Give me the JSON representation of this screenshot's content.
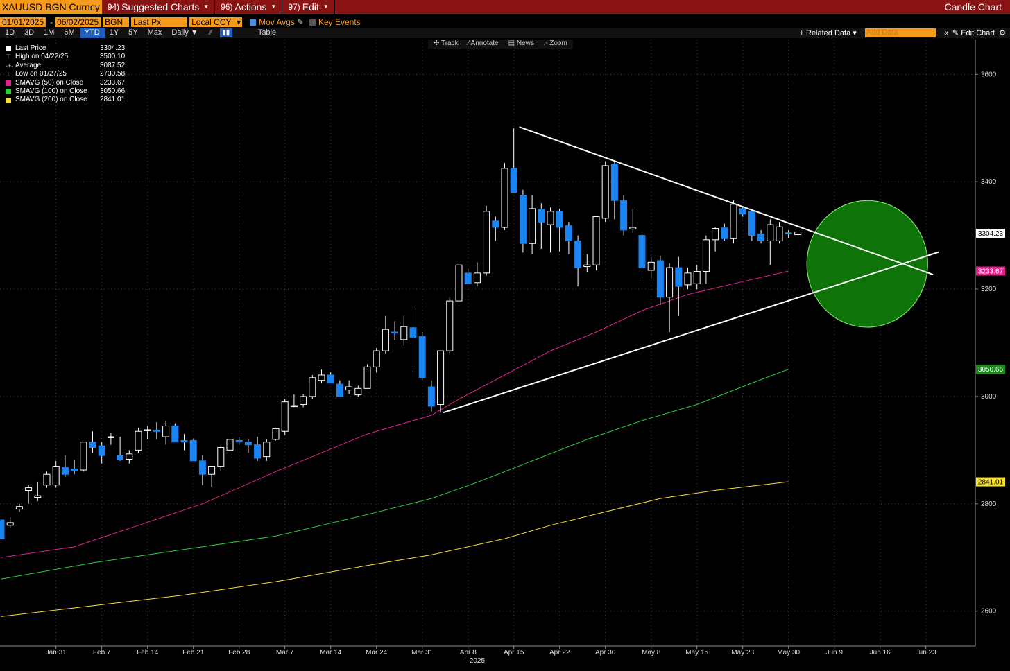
{
  "header": {
    "ticker": "XAUUSD BGN Curncy",
    "menus": [
      {
        "num": "94)",
        "label": "Suggested Charts"
      },
      {
        "num": "96)",
        "label": "Actions"
      },
      {
        "num": "97)",
        "label": "Edit"
      }
    ],
    "title": "Candle Chart"
  },
  "settings": {
    "start_date": "01/01/2025",
    "end_date": "06/02/2025",
    "source": "BGN",
    "field": "Last Px",
    "currency": "Local CCY",
    "mov_avgs_label": "Mov Avgs",
    "key_events_label": "Key Events"
  },
  "periods": [
    "1D",
    "3D",
    "1M",
    "6M",
    "YTD",
    "1Y",
    "5Y",
    "Max"
  ],
  "active_period": "YTD",
  "frequency": "Daily",
  "table_label": "Table",
  "related_data_label": "Related Data",
  "add_data_placeholder": "Add Data",
  "edit_chart_label": "Edit Chart",
  "tools": [
    "Track",
    "Annotate",
    "News",
    "Zoom"
  ],
  "legend": [
    {
      "label": "Last Price",
      "value": "3304.23",
      "color": "#ffffff",
      "sym": "square"
    },
    {
      "label": "High on 04/22/25",
      "value": "3500.10",
      "color": "#bbbbbb",
      "sym": "high"
    },
    {
      "label": "Average",
      "value": "3087.52",
      "color": "#bbbbbb",
      "sym": "avg"
    },
    {
      "label": "Low on 01/27/25",
      "value": "2730.58",
      "color": "#bbbbbb",
      "sym": "low"
    },
    {
      "label": "SMAVG (50)  on Close",
      "value": "3233.67",
      "color": "#e0218a",
      "sym": "square"
    },
    {
      "label": "SMAVG (100)  on Close",
      "value": "3050.66",
      "color": "#2ecc40",
      "sym": "square"
    },
    {
      "label": "SMAVG (200)  on Close",
      "value": "2841.01",
      "color": "#f7e03a",
      "sym": "square"
    }
  ],
  "chart_data": {
    "type": "candlestick",
    "ylim": [
      2535,
      3665
    ],
    "y_ticks": [
      2600,
      2800,
      3000,
      3200,
      3400,
      3600
    ],
    "x_ticks": [
      "Jan 31",
      "Feb 7",
      "Feb 14",
      "Feb 21",
      "Feb 28",
      "Mar 7",
      "Mar 14",
      "Mar 24",
      "Mar 31",
      "Apr 8",
      "Apr 15",
      "Apr 22",
      "Apr 30",
      "May 8",
      "May 15",
      "May 23",
      "May 30",
      "Jun 9",
      "Jun 16",
      "Jun 23"
    ],
    "x_year_label": "2025",
    "last_price_label": "3304.23",
    "colors": {
      "up_fill": "#000000",
      "up_border": "#ffffff",
      "down_fill": "#1a84f2",
      "last_fill": "#3ac6b4"
    },
    "candles": [
      {
        "o": 2770,
        "h": 2773,
        "l": 2731,
        "c": 2735
      },
      {
        "o": 2760,
        "h": 2775,
        "l": 2755,
        "c": 2765
      },
      {
        "o": 2790,
        "h": 2800,
        "l": 2785,
        "c": 2795
      },
      {
        "o": 2825,
        "h": 2835,
        "l": 2800,
        "c": 2830
      },
      {
        "o": 2812,
        "h": 2840,
        "l": 2805,
        "c": 2815
      },
      {
        "o": 2835,
        "h": 2860,
        "l": 2830,
        "c": 2855
      },
      {
        "o": 2835,
        "h": 2880,
        "l": 2830,
        "c": 2870
      },
      {
        "o": 2868,
        "h": 2890,
        "l": 2850,
        "c": 2855
      },
      {
        "o": 2865,
        "h": 2882,
        "l": 2855,
        "c": 2862
      },
      {
        "o": 2863,
        "h": 2915,
        "l": 2860,
        "c": 2915
      },
      {
        "o": 2915,
        "h": 2935,
        "l": 2895,
        "c": 2905
      },
      {
        "o": 2908,
        "h": 2915,
        "l": 2875,
        "c": 2890
      },
      {
        "o": 2925,
        "h": 2932,
        "l": 2910,
        "c": 2925
      },
      {
        "o": 2890,
        "h": 2925,
        "l": 2880,
        "c": 2882
      },
      {
        "o": 2883,
        "h": 2900,
        "l": 2875,
        "c": 2893
      },
      {
        "o": 2900,
        "h": 2942,
        "l": 2895,
        "c": 2935
      },
      {
        "o": 2938,
        "h": 2945,
        "l": 2920,
        "c": 2938
      },
      {
        "o": 2937,
        "h": 2952,
        "l": 2920,
        "c": 2935
      },
      {
        "o": 2925,
        "h": 2955,
        "l": 2910,
        "c": 2945
      },
      {
        "o": 2945,
        "h": 2950,
        "l": 2915,
        "c": 2915
      },
      {
        "o": 2918,
        "h": 2930,
        "l": 2900,
        "c": 2915
      },
      {
        "o": 2918,
        "h": 2920,
        "l": 2880,
        "c": 2880
      },
      {
        "o": 2880,
        "h": 2890,
        "l": 2835,
        "c": 2855
      },
      {
        "o": 2855,
        "h": 2870,
        "l": 2832,
        "c": 2870
      },
      {
        "o": 2870,
        "h": 2910,
        "l": 2862,
        "c": 2905
      },
      {
        "o": 2900,
        "h": 2925,
        "l": 2885,
        "c": 2920
      },
      {
        "o": 2918,
        "h": 2925,
        "l": 2910,
        "c": 2915
      },
      {
        "o": 2915,
        "h": 2920,
        "l": 2895,
        "c": 2910
      },
      {
        "o": 2910,
        "h": 2925,
        "l": 2880,
        "c": 2885
      },
      {
        "o": 2888,
        "h": 2920,
        "l": 2880,
        "c": 2915
      },
      {
        "o": 2920,
        "h": 2942,
        "l": 2918,
        "c": 2940
      },
      {
        "o": 2935,
        "h": 2995,
        "l": 2928,
        "c": 2990
      },
      {
        "o": 2983,
        "h": 3004,
        "l": 2980,
        "c": 2983
      },
      {
        "o": 2985,
        "h": 3005,
        "l": 2980,
        "c": 3000
      },
      {
        "o": 3000,
        "h": 3040,
        "l": 2995,
        "c": 3035
      },
      {
        "o": 3030,
        "h": 3050,
        "l": 3025,
        "c": 3040
      },
      {
        "o": 3040,
        "h": 3045,
        "l": 3030,
        "c": 3025
      },
      {
        "o": 3023,
        "h": 3030,
        "l": 3000,
        "c": 3000
      },
      {
        "o": 3012,
        "h": 3030,
        "l": 3005,
        "c": 3018
      },
      {
        "o": 3003,
        "h": 3020,
        "l": 3000,
        "c": 3015
      },
      {
        "o": 3015,
        "h": 3060,
        "l": 3015,
        "c": 3055
      },
      {
        "o": 3055,
        "h": 3090,
        "l": 3045,
        "c": 3085
      },
      {
        "o": 3085,
        "h": 3150,
        "l": 3080,
        "c": 3125
      },
      {
        "o": 3120,
        "h": 3140,
        "l": 3105,
        "c": 3118
      },
      {
        "o": 3106,
        "h": 3150,
        "l": 3095,
        "c": 3130
      },
      {
        "o": 3128,
        "h": 3168,
        "l": 3055,
        "c": 3110
      },
      {
        "o": 3112,
        "h": 3120,
        "l": 3030,
        "c": 3035
      },
      {
        "o": 3018,
        "h": 3030,
        "l": 2972,
        "c": 2982
      },
      {
        "o": 2985,
        "h": 3080,
        "l": 2970,
        "c": 3085
      },
      {
        "o": 3085,
        "h": 3185,
        "l": 3078,
        "c": 3178
      },
      {
        "o": 3178,
        "h": 3248,
        "l": 3170,
        "c": 3245
      },
      {
        "o": 3230,
        "h": 3238,
        "l": 3210,
        "c": 3210
      },
      {
        "o": 3212,
        "h": 3250,
        "l": 3205,
        "c": 3230
      },
      {
        "o": 3230,
        "h": 3355,
        "l": 3225,
        "c": 3345
      },
      {
        "o": 3327,
        "h": 3335,
        "l": 3290,
        "c": 3315
      },
      {
        "o": 3315,
        "h": 3435,
        "l": 3310,
        "c": 3425
      },
      {
        "o": 3425,
        "h": 3500,
        "l": 3380,
        "c": 3380
      },
      {
        "o": 3375,
        "h": 3385,
        "l": 3268,
        "c": 3285
      },
      {
        "o": 3285,
        "h": 3375,
        "l": 3265,
        "c": 3350
      },
      {
        "o": 3349,
        "h": 3360,
        "l": 3275,
        "c": 3325
      },
      {
        "o": 3320,
        "h": 3352,
        "l": 3268,
        "c": 3345
      },
      {
        "o": 3345,
        "h": 3350,
        "l": 3270,
        "c": 3315
      },
      {
        "o": 3318,
        "h": 3325,
        "l": 3265,
        "c": 3290
      },
      {
        "o": 3290,
        "h": 3300,
        "l": 3205,
        "c": 3240
      },
      {
        "o": 3242,
        "h": 3265,
        "l": 3232,
        "c": 3245
      },
      {
        "o": 3245,
        "h": 3330,
        "l": 3235,
        "c": 3335
      },
      {
        "o": 3332,
        "h": 3438,
        "l": 3325,
        "c": 3430
      },
      {
        "o": 3433,
        "h": 3438,
        "l": 3330,
        "c": 3365
      },
      {
        "o": 3365,
        "h": 3375,
        "l": 3300,
        "c": 3310
      },
      {
        "o": 3312,
        "h": 3350,
        "l": 3305,
        "c": 3315
      },
      {
        "o": 3300,
        "h": 3305,
        "l": 3215,
        "c": 3240
      },
      {
        "o": 3235,
        "h": 3260,
        "l": 3220,
        "c": 3250
      },
      {
        "o": 3253,
        "h": 3262,
        "l": 3170,
        "c": 3185
      },
      {
        "o": 3185,
        "h": 3248,
        "l": 3120,
        "c": 3240
      },
      {
        "o": 3240,
        "h": 3260,
        "l": 3150,
        "c": 3205
      },
      {
        "o": 3208,
        "h": 3240,
        "l": 3200,
        "c": 3230
      },
      {
        "o": 3210,
        "h": 3245,
        "l": 3200,
        "c": 3233
      },
      {
        "o": 3233,
        "h": 3300,
        "l": 3210,
        "c": 3292
      },
      {
        "o": 3292,
        "h": 3315,
        "l": 3270,
        "c": 3313
      },
      {
        "o": 3314,
        "h": 3322,
        "l": 3290,
        "c": 3294
      },
      {
        "o": 3294,
        "h": 3365,
        "l": 3285,
        "c": 3358
      },
      {
        "o": 3350,
        "h": 3355,
        "l": 3335,
        "c": 3340
      },
      {
        "o": 3345,
        "h": 3348,
        "l": 3290,
        "c": 3300
      },
      {
        "o": 3303,
        "h": 3310,
        "l": 3285,
        "c": 3290
      },
      {
        "o": 3290,
        "h": 3330,
        "l": 3245,
        "c": 3320
      },
      {
        "o": 3290,
        "h": 3325,
        "l": 3285,
        "c": 3316
      },
      {
        "o": 3305,
        "h": 3310,
        "l": 3295,
        "c": 3304
      }
    ],
    "series": [
      {
        "name": "SMAVG (50)",
        "color": "#e0218a",
        "points": [
          [
            0,
            2700
          ],
          [
            8,
            2720
          ],
          [
            15,
            2760
          ],
          [
            22,
            2800
          ],
          [
            30,
            2860
          ],
          [
            40,
            2930
          ],
          [
            47,
            2965
          ],
          [
            50,
            2995
          ],
          [
            55,
            3040
          ],
          [
            60,
            3085
          ],
          [
            65,
            3120
          ],
          [
            70,
            3160
          ],
          [
            75,
            3190
          ],
          [
            80,
            3210
          ],
          [
            86,
            3233.67
          ]
        ]
      },
      {
        "name": "SMAVG (100)",
        "color": "#2ecc40",
        "points": [
          [
            0,
            2660
          ],
          [
            10,
            2690
          ],
          [
            20,
            2715
          ],
          [
            30,
            2740
          ],
          [
            40,
            2780
          ],
          [
            47,
            2810
          ],
          [
            52,
            2840
          ],
          [
            58,
            2880
          ],
          [
            64,
            2920
          ],
          [
            70,
            2955
          ],
          [
            76,
            2985
          ],
          [
            82,
            3025
          ],
          [
            86,
            3050.66
          ]
        ]
      },
      {
        "name": "SMAVG (200)",
        "color": "#f7e03a",
        "points": [
          [
            0,
            2590
          ],
          [
            10,
            2610
          ],
          [
            20,
            2630
          ],
          [
            30,
            2655
          ],
          [
            40,
            2685
          ],
          [
            47,
            2705
          ],
          [
            55,
            2735
          ],
          [
            60,
            2760
          ],
          [
            66,
            2785
          ],
          [
            72,
            2810
          ],
          [
            78,
            2825
          ],
          [
            86,
            2841.01
          ]
        ]
      }
    ],
    "annotations": {
      "lower_trendline": [
        [
          48.3,
          2970
        ],
        [
          102.4,
          3269
        ]
      ],
      "upper_trendline": [
        [
          56.6,
          3502
        ],
        [
          101.8,
          3227
        ]
      ],
      "circle": {
        "cx": 94.6,
        "cy": 3247,
        "rx": 6.6,
        "ry": 118
      }
    }
  }
}
